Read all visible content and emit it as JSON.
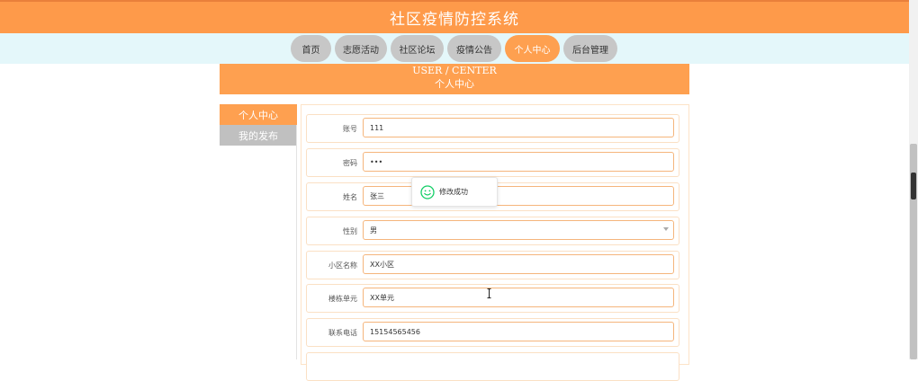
{
  "header": {
    "title": "社区疫情防控系统"
  },
  "nav": {
    "items": [
      {
        "label": "首页"
      },
      {
        "label": "志愿活动"
      },
      {
        "label": "社区论坛"
      },
      {
        "label": "疫情公告"
      },
      {
        "label": "个人中心"
      },
      {
        "label": "后台管理"
      }
    ],
    "active": "个人中心"
  },
  "banner": {
    "en": "USER / CENTER",
    "cn": "个人中心"
  },
  "sidebar": {
    "items": [
      {
        "label": "个人中心"
      },
      {
        "label": "我的发布"
      }
    ]
  },
  "form": {
    "account": {
      "label": "账号",
      "value": "111"
    },
    "password": {
      "label": "密码",
      "value": "•••"
    },
    "name": {
      "label": "姓名",
      "value": "张三"
    },
    "gender": {
      "label": "性别",
      "value": "男"
    },
    "community": {
      "label": "小区名称",
      "value": "XX小区"
    },
    "building": {
      "label": "楼栋单元",
      "value": "XX单元"
    },
    "phone": {
      "label": "联系电话",
      "value": "15154565456"
    }
  },
  "toast": {
    "message": "修改成功"
  },
  "colors": {
    "accent": "#fea050",
    "nav_background": "#e4f7fa",
    "nav_inactive": "#c7c7c7",
    "success": "#13ce66"
  }
}
